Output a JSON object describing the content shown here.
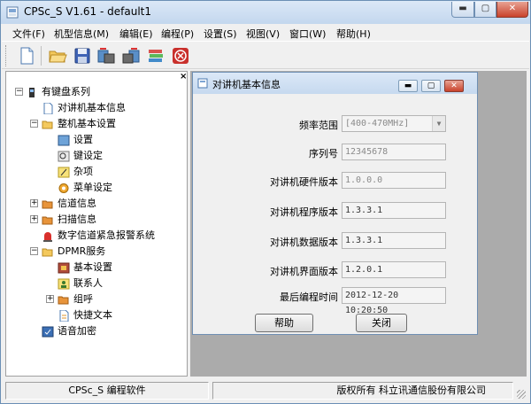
{
  "window": {
    "title": "CPSc_S V1.61 - default1"
  },
  "menu": [
    "文件(F)",
    "机型信息(M)",
    "编辑(E)",
    "编程(P)",
    "设置(S)",
    "视图(V)",
    "窗口(W)",
    "帮助(H)"
  ],
  "toolbar": {
    "buttons": [
      {
        "icon": "new-document-icon"
      },
      {
        "icon": "open-folder-icon"
      },
      {
        "icon": "save-disk-icon"
      },
      {
        "icon": "read-radio-icon"
      },
      {
        "icon": "write-radio-icon"
      },
      {
        "icon": "books-icon"
      },
      {
        "icon": "stop-icon"
      }
    ]
  },
  "tree": {
    "close_glyph": "×",
    "items": [
      {
        "label": "有键盘系列"
      },
      {
        "label": "对讲机基本信息"
      },
      {
        "label": "整机基本设置"
      },
      {
        "label": "设置"
      },
      {
        "label": "键设定"
      },
      {
        "label": "杂项"
      },
      {
        "label": "菜单设定"
      },
      {
        "label": "信道信息"
      },
      {
        "label": "扫描信息"
      },
      {
        "label": "数字信道紧急报警系统"
      },
      {
        "label": "DPMR服务"
      },
      {
        "label": "基本设置"
      },
      {
        "label": "联系人"
      },
      {
        "label": "组呼"
      },
      {
        "label": "快捷文本"
      },
      {
        "label": "语音加密"
      }
    ]
  },
  "dialog": {
    "title": "对讲机基本信息",
    "fields": [
      {
        "label": "频率范围",
        "value": "[400-470MHz]"
      },
      {
        "label": "序列号",
        "value": "12345678"
      },
      {
        "label": "对讲机硬件版本",
        "value": "1.0.0.0"
      },
      {
        "label": "对讲机程序版本",
        "value": "1.3.3.1"
      },
      {
        "label": "对讲机数据版本",
        "value": "1.3.3.1"
      },
      {
        "label": "对讲机界面版本",
        "value": "1.2.0.1"
      },
      {
        "label": "最后编程时间",
        "value": "2012-12-20 10:20:50"
      }
    ],
    "help_button": "帮助",
    "close_button": "关闭"
  },
  "status": {
    "left": "CPSc_S 编程软件",
    "right": "版权所有 科立讯通信股份有限公司"
  },
  "colors": {
    "accent": "#c9422b",
    "titlebar": "#c3d7ee",
    "mdi_bg": "#ababab"
  }
}
